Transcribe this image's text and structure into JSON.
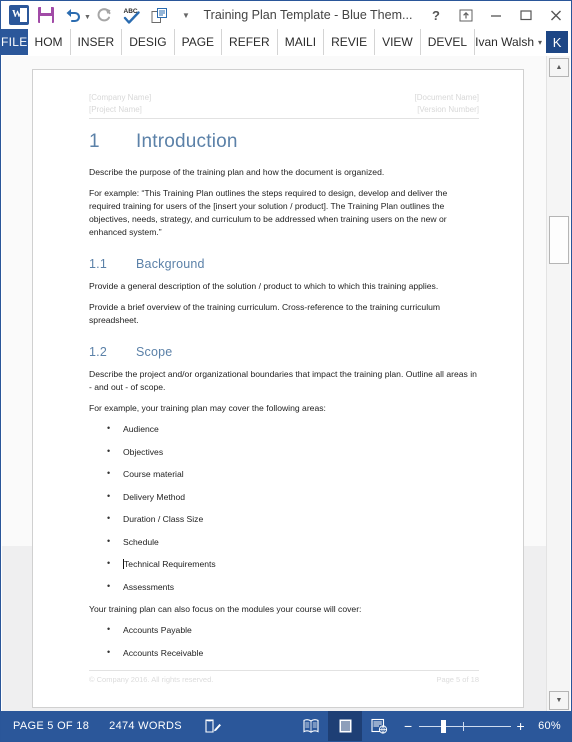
{
  "window": {
    "title": "Training Plan Template - Blue Them...",
    "quick_access": [
      {
        "name": "word-logo-icon",
        "label": "W"
      },
      {
        "name": "save-icon",
        "label": "Save"
      },
      {
        "name": "undo-icon",
        "label": "Undo"
      },
      {
        "name": "redo-icon",
        "label": "Redo"
      },
      {
        "name": "spelling-check-icon",
        "label": "ABC"
      },
      {
        "name": "print-preview-icon",
        "label": "Print Preview and Print"
      },
      {
        "name": "customize-quick-access-toolbar-icon",
        "label": "Customize Quick Access Toolbar"
      }
    ],
    "controls": {
      "help": "?",
      "ribbon_display_options": "Ribbon Display Options",
      "minimize": "Minimize",
      "restore": "Restore Down",
      "close": "Close"
    }
  },
  "ribbon": {
    "file_tab": "FILE",
    "tabs": [
      "HOM",
      "INSER",
      "DESIG",
      "PAGE",
      "REFER",
      "MAILI",
      "REVIE",
      "VIEW",
      "DEVEL"
    ],
    "account": {
      "name": "Ivan Walsh",
      "avatar_initial": "K",
      "caret": "▾"
    }
  },
  "document": {
    "header": {
      "left_top": "[Company Name]",
      "left_bottom": "[Project Name]",
      "right_top": "[Document Name]",
      "right_bottom": "[Version Number]"
    },
    "sections": [
      {
        "type": "h1",
        "number": "1",
        "title": "Introduction"
      },
      {
        "type": "p",
        "text": "Describe the purpose of the training plan and how the document is organized."
      },
      {
        "type": "p",
        "text": "For example: “This Training Plan outlines the steps required to design, develop and deliver the required training for users of the [insert your solution / product]. The Training Plan outlines the objectives, needs, strategy, and curriculum to be addressed when training users on the new or enhanced system.”"
      },
      {
        "type": "h2",
        "number": "1.1",
        "title": "Background"
      },
      {
        "type": "p",
        "text": "Provide a general description of the solution / product to which to which this training applies."
      },
      {
        "type": "p",
        "text": "Provide a brief overview of the training curriculum. Cross-reference to the training curriculum spreadsheet."
      },
      {
        "type": "h2",
        "number": "1.2",
        "title": "Scope"
      },
      {
        "type": "p",
        "text": "Describe the project and/or organizational boundaries that impact the training plan. Outline all areas in - and out - of scope."
      },
      {
        "type": "p",
        "text": "For example, your training plan may cover the following areas:"
      }
    ],
    "bullets_scope": [
      "Audience",
      "Objectives",
      "Course material",
      "Delivery Method",
      "Duration / Class Size",
      "Schedule",
      "Technical Requirements",
      "Assessments"
    ],
    "caret_before_bullet_index": 6,
    "modules_intro": "Your training plan can also focus on the modules your course will cover:",
    "bullets_modules": [
      "Accounts Payable",
      "Accounts Receivable"
    ],
    "footer": {
      "left": "© Company 2016. All rights reserved.",
      "right": "Page 5 of 18"
    }
  },
  "scrollbar": {
    "up_arrow": "▲",
    "down_arrow": "▼"
  },
  "statusbar": {
    "page_label": "PAGE 5 OF 18",
    "word_count": "2474 WORDS",
    "proofing_icon": "proofing-errors-icon",
    "views": [
      {
        "name": "read-mode-view-button",
        "label": "Read Mode",
        "active": false
      },
      {
        "name": "print-layout-view-button",
        "label": "Print Layout",
        "active": true
      },
      {
        "name": "web-layout-view-button",
        "label": "Web Layout",
        "active": false
      }
    ],
    "zoom_out": "−",
    "zoom_in": "+",
    "zoom_level": "60%"
  },
  "colors": {
    "word_blue": "#2b579a",
    "heading_blue": "#5b81a8",
    "save_purple": "#a14ba7",
    "avatar_blue": "#1d4685"
  }
}
